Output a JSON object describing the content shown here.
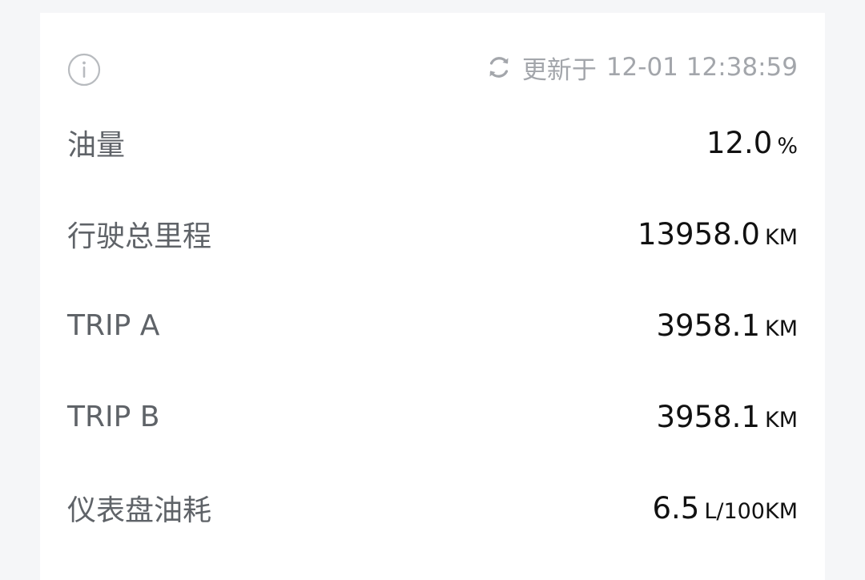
{
  "header": {
    "info_icon": "info-circle-icon",
    "refresh_icon": "refresh-icon",
    "update_prefix": "更新于",
    "update_time": "12-01 12:38:59"
  },
  "metrics": [
    {
      "label": "油量",
      "value": "12.0",
      "unit": "%"
    },
    {
      "label": "行驶总里程",
      "value": "13958.0",
      "unit": "KM"
    },
    {
      "label": "TRIP A",
      "value": "3958.1",
      "unit": "KM"
    },
    {
      "label": "TRIP B",
      "value": "3958.1",
      "unit": "KM"
    },
    {
      "label": "仪表盘油耗",
      "value": "6.5",
      "unit": "L/100KM"
    }
  ],
  "colors": {
    "background": "#f5f6f8",
    "card": "#ffffff",
    "label_text": "#5f6368",
    "value_text": "#111111",
    "muted_text": "#a3a6ab"
  }
}
